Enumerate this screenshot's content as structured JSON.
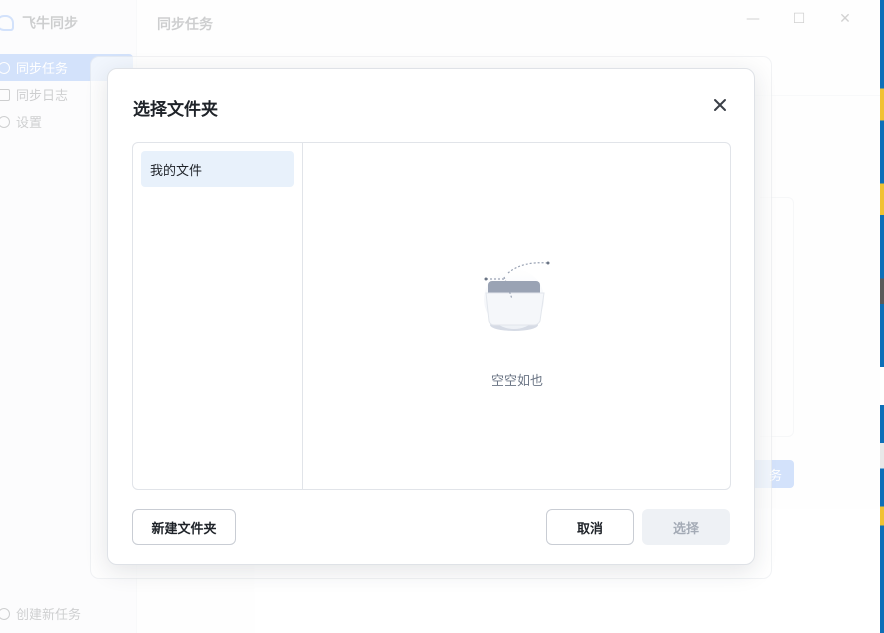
{
  "app": {
    "brand": "飞牛同步",
    "title": "同步任务",
    "nav": [
      {
        "label": "同步任务",
        "icon": "sync-icon",
        "active": true
      },
      {
        "label": "同步日志",
        "icon": "log-icon",
        "active": false
      },
      {
        "label": "设置",
        "icon": "settings-icon",
        "active": false
      }
    ],
    "bottom_action": "创建新任务",
    "side_button_label": "务",
    "window_controls": {
      "minimize": "—",
      "maximize": "☐",
      "close": "✕"
    }
  },
  "dialog": {
    "title": "选择文件夹",
    "tree": [
      {
        "label": "我的文件",
        "selected": true
      }
    ],
    "empty_text": "空空如也",
    "buttons": {
      "new_folder": "新建文件夹",
      "cancel": "取消",
      "select": "选择"
    }
  },
  "colors": {
    "accent": "#3a7df0",
    "selected_bg": "#e8f1fb",
    "disabled_bg": "#eef1f5",
    "disabled_text": "#a4abb6"
  }
}
